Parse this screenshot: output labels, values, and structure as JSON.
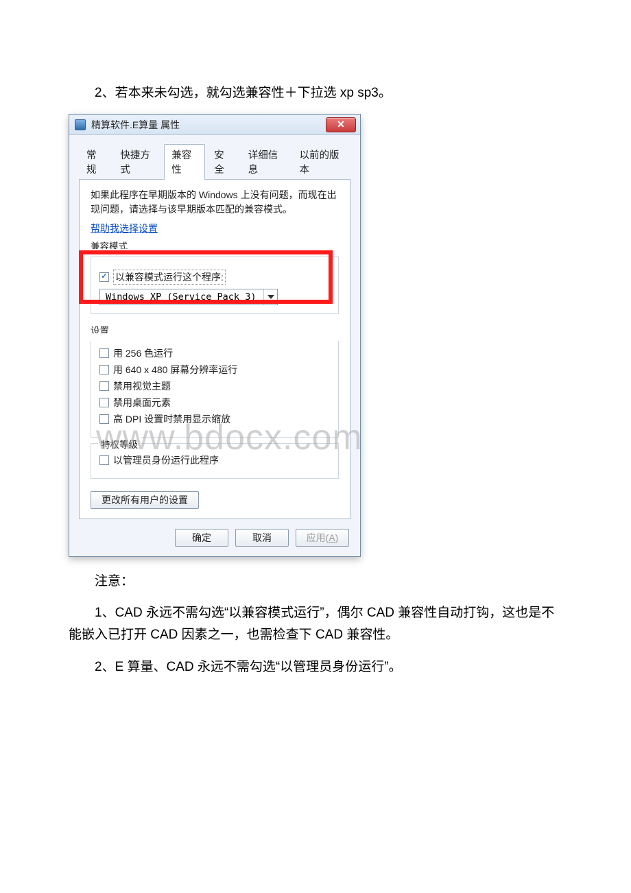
{
  "doc": {
    "line1": "2、若本来未勾选，就勾选兼容性＋下拉选 xp sp3。",
    "note_heading": "注意：",
    "note1": "1、CAD 永远不需勾选“以兼容模式运行”，偶尔 CAD 兼容性自动打钩，这也是不能嵌入已打开 CAD 因素之一，也需检查下 CAD 兼容性。",
    "note2": "2、E 算量、CAD 永远不需勾选“以管理员身份运行”。"
  },
  "dlg": {
    "title": "精算软件.E算量 属性",
    "tabs": {
      "general": "常规",
      "shortcut": "快捷方式",
      "compat": "兼容性",
      "security": "安全",
      "details": "详细信息",
      "prev": "以前的版本"
    },
    "intro_l1": "如果此程序在早期版本的 Windows 上没有问题，而现在出",
    "intro_l2": "现问题，请选择与该早期版本匹配的兼容模式。",
    "help_link": "帮助我选择设置",
    "group_compat_label": "兼容模式",
    "compat_checkbox": "以兼容模式运行这个程序:",
    "compat_select": "Windows XP (Service Pack 3)",
    "group_settings_label": "设置",
    "settings": {
      "color256": "用 256 色运行",
      "res640": "用 640 x 480 屏幕分辨率运行",
      "disable_theme": "禁用视觉主题",
      "disable_desktop": "禁用桌面元素",
      "disable_dpi": "高 DPI 设置时禁用显示缩放"
    },
    "group_priv_label": "特权等级",
    "priv_admin": "以管理员身份运行此程序",
    "change_all_users": "更改所有用户的设置",
    "ok": "确定",
    "cancel": "取消",
    "apply_text": "应用(",
    "apply_u": "A",
    "apply_tail": ")"
  },
  "watermark": "www.bdocx.com"
}
